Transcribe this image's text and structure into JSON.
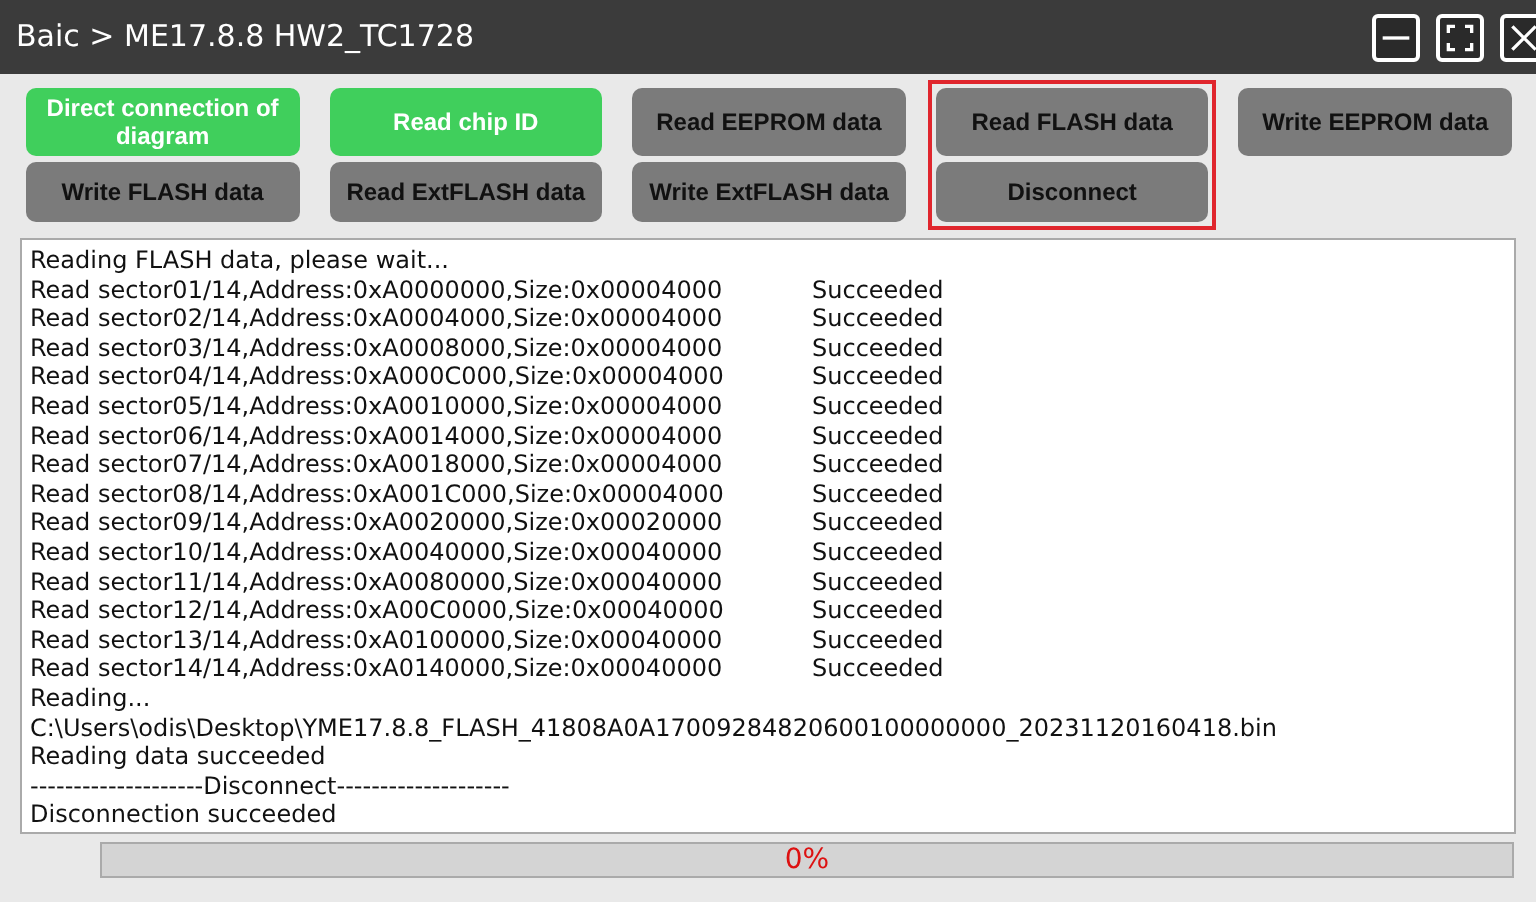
{
  "window": {
    "title": "Baic > ME17.8.8 HW2_TC1728"
  },
  "button_columns": [
    {
      "highlighted": false,
      "buttons": [
        {
          "label": "Direct connection of diagram",
          "color": "#40cf5c"
        },
        {
          "label": "Write FLASH data",
          "color": "#7b7b7b"
        }
      ]
    },
    {
      "highlighted": false,
      "buttons": [
        {
          "label": "Read chip ID",
          "color": "#40cf5c"
        },
        {
          "label": "Read ExtFLASH data",
          "color": "#7b7b7b"
        }
      ]
    },
    {
      "highlighted": false,
      "buttons": [
        {
          "label": "Read EEPROM data",
          "color": "#7b7b7b"
        },
        {
          "label": "Write ExtFLASH data",
          "color": "#7b7b7b"
        }
      ]
    },
    {
      "highlighted": true,
      "buttons": [
        {
          "label": "Read FLASH data",
          "color": "#7b7b7b"
        },
        {
          "label": "Disconnect",
          "color": "#7b7b7b"
        }
      ]
    },
    {
      "highlighted": false,
      "buttons": [
        {
          "label": "Write EEPROM data",
          "color": "#7b7b7b"
        }
      ]
    }
  ],
  "log": [
    {
      "text": "Reading FLASH data, please wait..."
    },
    {
      "text": "Read sector01/14,Address:0xA0000000,Size:0x00004000",
      "result": "Succeeded"
    },
    {
      "text": "Read sector02/14,Address:0xA0004000,Size:0x00004000",
      "result": "Succeeded"
    },
    {
      "text": "Read sector03/14,Address:0xA0008000,Size:0x00004000",
      "result": "Succeeded"
    },
    {
      "text": "Read sector04/14,Address:0xA000C000,Size:0x00004000",
      "result": "Succeeded"
    },
    {
      "text": "Read sector05/14,Address:0xA0010000,Size:0x00004000",
      "result": "Succeeded"
    },
    {
      "text": "Read sector06/14,Address:0xA0014000,Size:0x00004000",
      "result": "Succeeded"
    },
    {
      "text": "Read sector07/14,Address:0xA0018000,Size:0x00004000",
      "result": "Succeeded"
    },
    {
      "text": "Read sector08/14,Address:0xA001C000,Size:0x00004000",
      "result": "Succeeded"
    },
    {
      "text": "Read sector09/14,Address:0xA0020000,Size:0x00020000",
      "result": "Succeeded"
    },
    {
      "text": "Read sector10/14,Address:0xA0040000,Size:0x00040000",
      "result": "Succeeded"
    },
    {
      "text": "Read sector11/14,Address:0xA0080000,Size:0x00040000",
      "result": "Succeeded"
    },
    {
      "text": "Read sector12/14,Address:0xA00C0000,Size:0x00040000",
      "result": "Succeeded"
    },
    {
      "text": "Read sector13/14,Address:0xA0100000,Size:0x00040000",
      "result": "Succeeded"
    },
    {
      "text": "Read sector14/14,Address:0xA0140000,Size:0x00040000",
      "result": "Succeeded"
    },
    {
      "text": "Reading..."
    },
    {
      "text": "C:\\Users\\odis\\Desktop\\YME17.8.8_FLASH_41808A0A17009284820600100000000_20231120160418.bin"
    },
    {
      "text": "Reading data succeeded"
    },
    {
      "text": "--------------------Disconnect--------------------"
    },
    {
      "text": "Disconnection succeeded"
    }
  ],
  "progress": {
    "level": 0,
    "label": "0%"
  }
}
